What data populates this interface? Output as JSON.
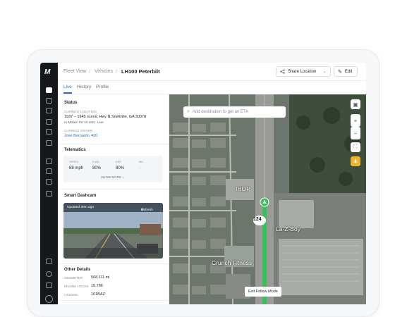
{
  "header": {
    "crumb_fleet": "Fleet View",
    "crumb_vehicles": "Vehicles",
    "title": "LH100 Peterbilt",
    "share_label": "Share Location",
    "edit_label": "Edit"
  },
  "tabs": [
    {
      "label": "Live"
    },
    {
      "label": "History"
    },
    {
      "label": "Profile"
    }
  ],
  "status": {
    "title": "Status",
    "location_label": "CURRENT LOCATION",
    "location_value": "1937 – 1945 scenic Hwy N Snellville, GA 30078",
    "motion": "In Motion for 1h 10m",
    "live": "Live",
    "driver_label": "CURRENT DRIVER",
    "driver_name": "Jose Bernardo",
    "driver_id": "420"
  },
  "telematics": {
    "title": "Telematics",
    "speed_label": "SPEED",
    "speed_value": "68 mph",
    "fuel_label": "FUEL",
    "fuel_value": "80%",
    "def_label": "DEF",
    "def_value": "80%",
    "mil_label": "MIL",
    "show_more": "SHOW MORE"
  },
  "dashcam": {
    "title": "Smart Dashcam",
    "updated": "Updated 30m ago",
    "refresh": "Refresh"
  },
  "other": {
    "title": "Other Details",
    "odometer_label": "ODOMETER",
    "odometer_value": "568,111 mi",
    "engine_label": "ENGINE HOURS",
    "engine_value": "19,786",
    "license_label": "LICENSE",
    "license_value": "101BAZ"
  },
  "map": {
    "search_placeholder": "Add destination to get an ETA",
    "poi_ihop": "IHOP",
    "poi_lazboy": "La-Z-Boy",
    "poi_crunch": "Crunch Fitness",
    "route_marker": "124",
    "exit_follow": "Exit Follow Mode"
  },
  "colors": {
    "accent": "#1a6fd1",
    "rail": "#16181c",
    "route": "#3bbf5c"
  }
}
